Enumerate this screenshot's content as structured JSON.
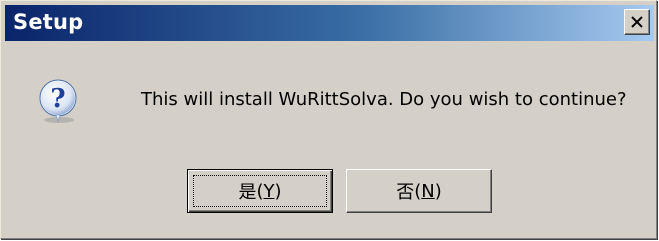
{
  "window": {
    "title": "Setup",
    "close_icon": "close-icon"
  },
  "dialog": {
    "icon": "question-icon",
    "message": "This will install WuRittSolva. Do you wish to continue?"
  },
  "buttons": {
    "yes": {
      "label": "是",
      "open": "(",
      "mnemonic": "Y",
      "close": ")"
    },
    "no": {
      "label": "否",
      "open": "(",
      "mnemonic": "N",
      "close": ")"
    }
  },
  "colors": {
    "title_start": "#0a246a",
    "title_end": "#a6caf0",
    "dialog_bg": "#d4d0c8"
  }
}
